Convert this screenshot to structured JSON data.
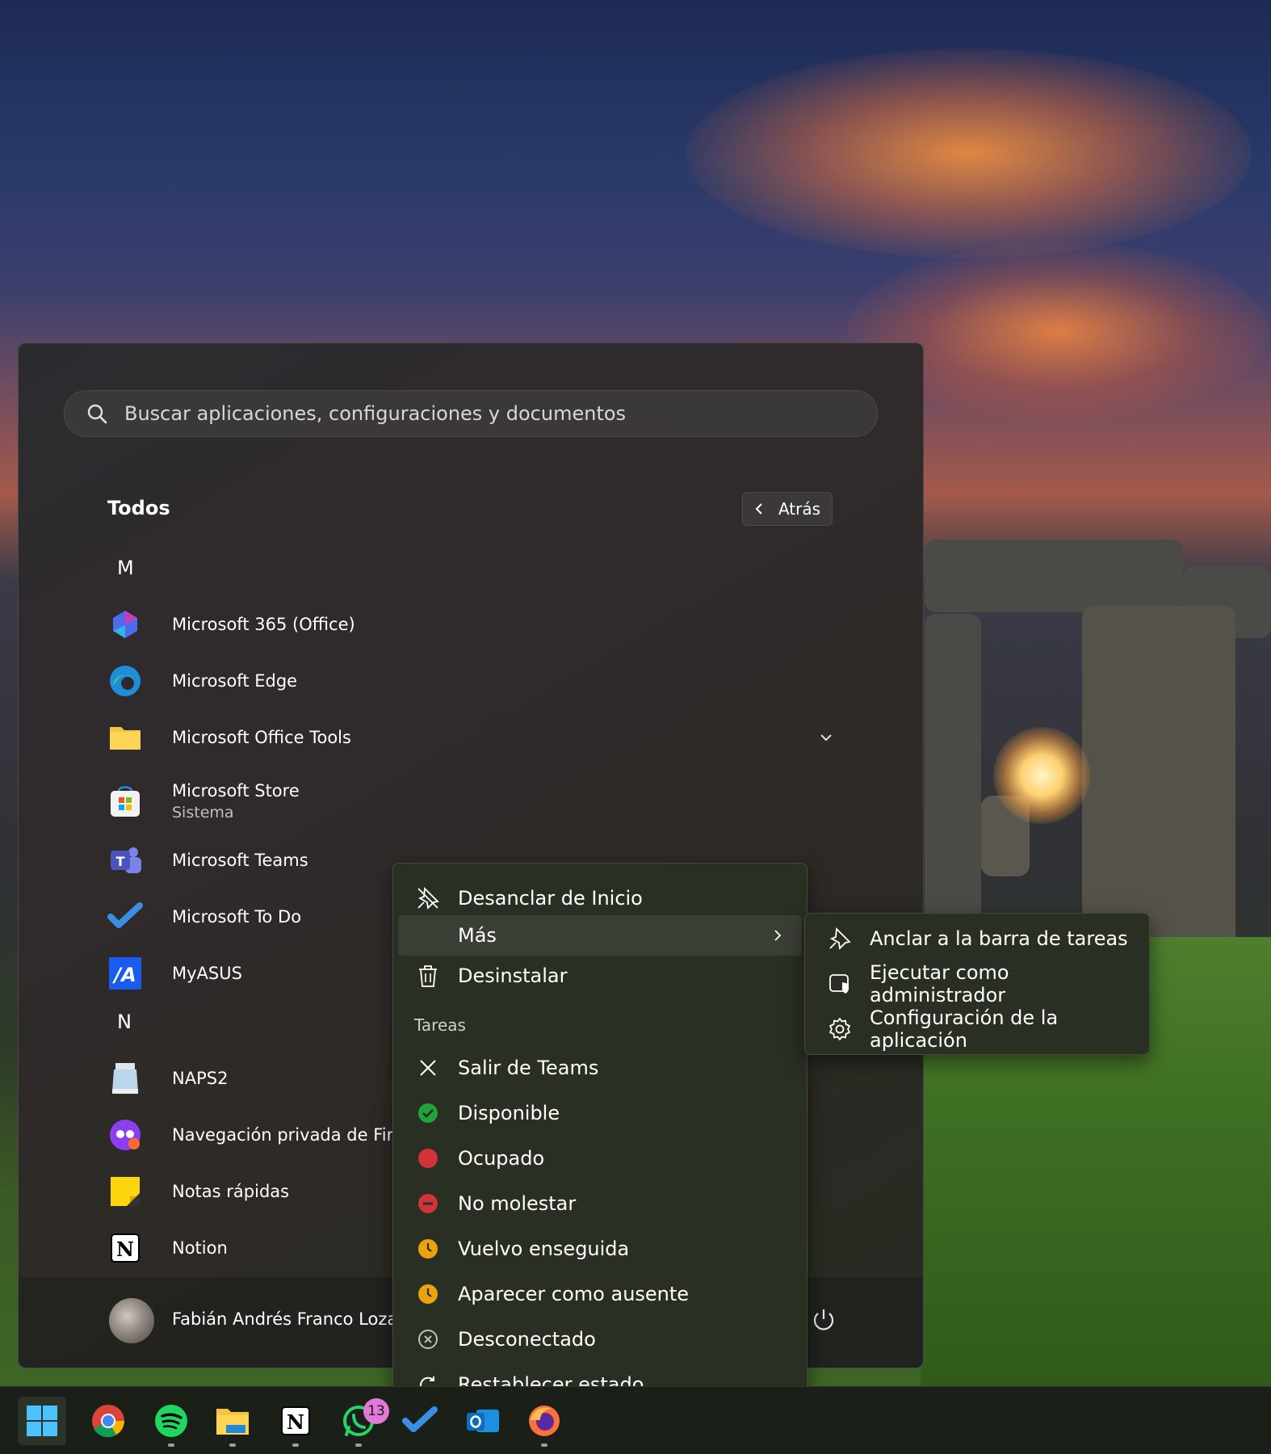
{
  "search": {
    "placeholder": "Buscar aplicaciones, configuraciones y documentos"
  },
  "list": {
    "title": "Todos",
    "back_label": "Atrás",
    "letters": [
      "M",
      "N"
    ],
    "apps": [
      {
        "name": "Microsoft 365 (Office)",
        "icon": "microsoft-365-icon"
      },
      {
        "name": "Microsoft Edge",
        "icon": "edge-icon"
      },
      {
        "name": "Microsoft Office Tools",
        "icon": "folder-icon"
      },
      {
        "name": "Microsoft Store",
        "sub": "Sistema",
        "icon": "store-icon"
      },
      {
        "name": "Microsoft Teams",
        "icon": "teams-icon"
      },
      {
        "name": "Microsoft To Do",
        "icon": "todo-icon"
      },
      {
        "name": "MyASUS",
        "icon": "myasus-icon"
      },
      {
        "name": "NAPS2",
        "icon": "scanner-icon"
      },
      {
        "name": "Navegación privada de Firefo",
        "icon": "firefox-private-icon"
      },
      {
        "name": "Notas rápidas",
        "icon": "sticky-notes-icon"
      },
      {
        "name": "Notion",
        "icon": "notion-icon"
      }
    ]
  },
  "user": {
    "name": "Fabián Andrés Franco Lozada"
  },
  "context_menu": {
    "unpin": "Desanclar de Inicio",
    "more": "Más",
    "uninstall": "Desinstalar",
    "section": "Tareas",
    "tasks": [
      {
        "label": "Salir de Teams",
        "icon": "close-icon"
      },
      {
        "label": "Disponible",
        "icon": "status-available-icon",
        "color": "#22a33a"
      },
      {
        "label": "Ocupado",
        "icon": "status-busy-icon",
        "color": "#d13438"
      },
      {
        "label": "No molestar",
        "icon": "status-dnd-icon",
        "color": "#d13438"
      },
      {
        "label": "Vuelvo enseguida",
        "icon": "status-away-icon",
        "color": "#e8a30e"
      },
      {
        "label": "Aparecer como ausente",
        "icon": "status-away-icon",
        "color": "#e8a30e"
      },
      {
        "label": "Desconectado",
        "icon": "status-offline-icon"
      },
      {
        "label": "Restablecer estado",
        "icon": "reset-icon"
      }
    ]
  },
  "submenu": {
    "items": [
      {
        "label": "Anclar a la barra de tareas",
        "icon": "pin-icon"
      },
      {
        "label": "Ejecutar como administrador",
        "icon": "admin-shield-icon"
      },
      {
        "label": "Configuración de la aplicación",
        "icon": "gear-icon"
      }
    ]
  },
  "taskbar": {
    "items": [
      "start-icon",
      "chrome-icon",
      "spotify-icon",
      "file-explorer-icon",
      "notion-icon",
      "whatsapp-icon",
      "todo-icon",
      "outlook-icon",
      "firefox-icon"
    ],
    "whatsapp_badge": "13"
  }
}
